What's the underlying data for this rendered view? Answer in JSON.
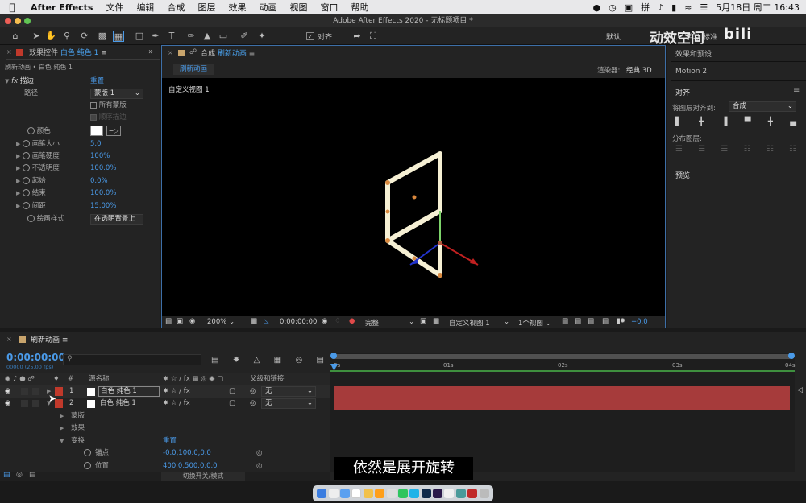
{
  "menubar": {
    "app": "After Effects",
    "items": [
      "文件",
      "编辑",
      "合成",
      "图层",
      "效果",
      "动画",
      "视图",
      "窗口",
      "帮助"
    ],
    "status_input": "拼",
    "date": "5月18日 周二 16:43"
  },
  "window": {
    "title": "Adobe After Effects 2020 - 无标题项目 *"
  },
  "toolbar": {
    "align_label": "对齐",
    "workspace_default": "默认",
    "workspace_learn": "学习",
    "workspace_std": "标准",
    "watermark": "动效空间"
  },
  "effects_panel": {
    "tab_label": "效果控件",
    "tab_layer": "白色 纯色 1",
    "breadcrumb": "刷新动画 • 白色 纯色 1",
    "effect_name": "描边",
    "reset": "重置",
    "path_label": "路径",
    "path_value": "蒙版 1",
    "all_masks": "所有蒙版",
    "sequential": "顺序描边",
    "params": [
      {
        "label": "颜色",
        "value": ""
      },
      {
        "label": "画笔大小",
        "value": "5.0"
      },
      {
        "label": "画笔硬度",
        "value": "100%"
      },
      {
        "label": "不透明度",
        "value": "100.0%"
      },
      {
        "label": "起始",
        "value": "0.0%"
      },
      {
        "label": "结束",
        "value": "100.0%"
      },
      {
        "label": "间距",
        "value": "15.00%"
      }
    ],
    "paint_style_label": "绘画样式",
    "paint_style_value": "在透明背景上"
  },
  "comp_panel": {
    "tab_prefix": "合成",
    "tab_name": "刷新动画",
    "subtab": "刷新动画",
    "renderer_label": "渲染器:",
    "renderer_value": "经典 3D",
    "view_label": "自定义视图 1",
    "zoom": "200%",
    "timecode": "0:00:00:00",
    "quality": "完整",
    "view_select": "自定义视图 1",
    "views_count": "1个视图",
    "exposure": "+0.0"
  },
  "right_panel": {
    "effects_presets": "效果和预设",
    "motion2": "Motion 2",
    "align_title": "对齐",
    "align_to_label": "将图层对齐到:",
    "align_to_value": "合成",
    "distribute_label": "分布图层:",
    "preview_title": "预览"
  },
  "timeline": {
    "tab_name": "刷新动画",
    "timecode": "0:00:00:00",
    "fps": "00000 (25.00 fps)",
    "search_placeholder": "",
    "col_source": "源名称",
    "col_parent": "父级和链接",
    "layers": [
      {
        "num": "1",
        "name": "白色 纯色 1",
        "parent": "无"
      },
      {
        "num": "2",
        "name": "白色 纯色 1",
        "parent": "无"
      }
    ],
    "sub_mask": "蒙版",
    "sub_effects": "效果",
    "sub_transform": "变换",
    "transform_reset": "重置",
    "anchor_label": "锚点",
    "anchor_value": "-0.0,100.0,0.0",
    "position_label": "位置",
    "position_value": "400.0,500.0,0.0",
    "toggle_label": "切换开关/模式",
    "ruler": [
      "0s",
      "01s",
      "02s",
      "03s",
      "04s"
    ]
  },
  "subtitle": "依然是展开旋转",
  "colors": {
    "accent": "#4a9ae8",
    "layer_bar": "#a63b3b",
    "label_red": "#c0392b"
  }
}
